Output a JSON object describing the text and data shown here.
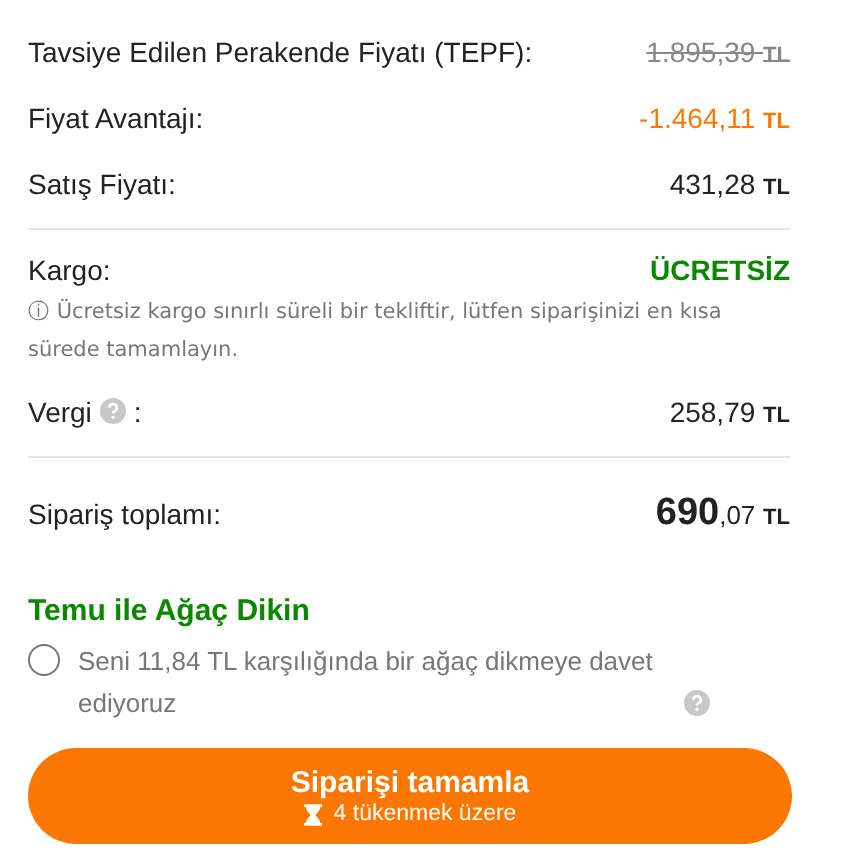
{
  "price_rows": [
    {
      "label": "Tavsiye Edilen Perakende Fiyatı (TEPF):",
      "amount": "1.895,39",
      "currency": "TL",
      "kind": "struck"
    },
    {
      "label": "Fiyat Avantajı:",
      "amount": "-1.464,11",
      "currency": "TL",
      "kind": "discount"
    },
    {
      "label": "Satış Fiyatı:",
      "amount": "431,28",
      "currency": "TL",
      "kind": "normal"
    }
  ],
  "shipping": {
    "label": "Kargo:",
    "value": "ÜCRETSİZ",
    "note": "ⓘ Ücretsiz kargo sınırlı süreli bir tekliftir, lütfen siparişinizi en kısa sürede tamamlayın."
  },
  "tax": {
    "label": "Vergi",
    "colon": ":",
    "amount": "258,79",
    "currency": "TL"
  },
  "total": {
    "label": "Sipariş toplamı:",
    "amount": "690",
    "fraction": ",07",
    "currency": "TL"
  },
  "tree_offer": {
    "title": "Temu ile Ağaç Dikin",
    "text": "Seni 11,84 TL karşılığında bir ağaç dikmeye davet ediyoruz",
    "checked": false
  },
  "checkout_button": {
    "label": "Siparişi tamamla",
    "stock_note": "4 tükenmek üzere"
  }
}
